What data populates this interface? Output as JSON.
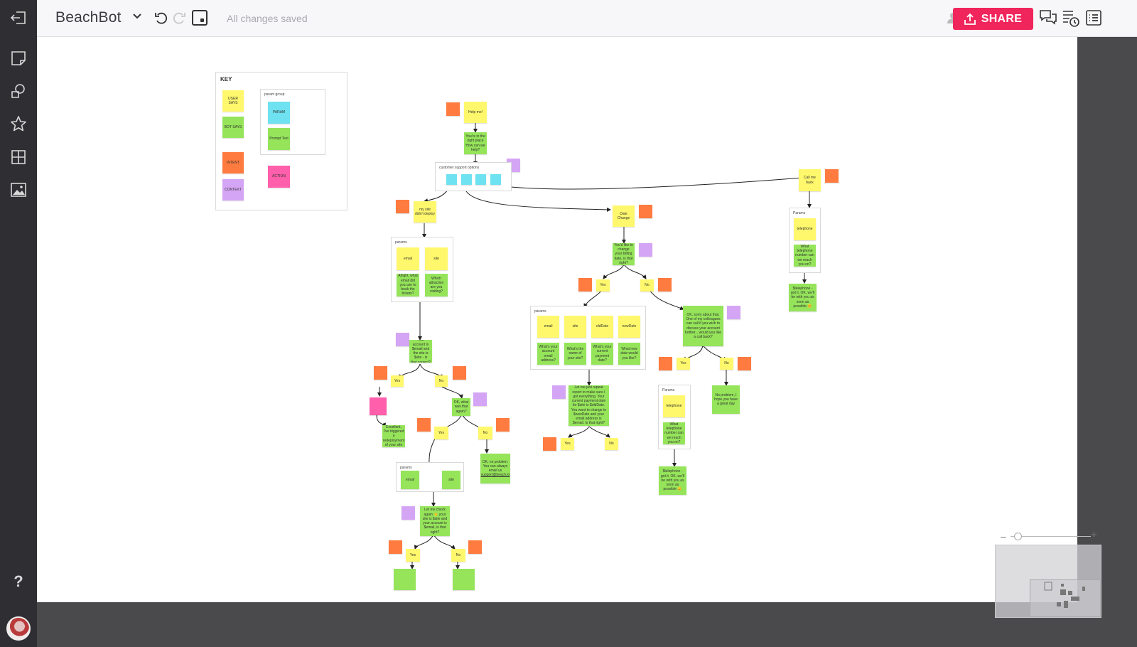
{
  "topbar": {
    "board_title": "BeachBot",
    "save_status": "All changes saved",
    "user_count": "1",
    "share_label": "SHARE"
  },
  "colors": {
    "accent": "#f0255b",
    "user_says": "#fff86c",
    "bot_says": "#95e45a",
    "intent": "#ff7b3f",
    "context": "#d5a5f5",
    "param": "#6ee2f0",
    "action": "#ff5fab"
  },
  "key": {
    "title": "KEY",
    "user_says": "USER SAYS",
    "bot_says": "BOT SAYS",
    "intent": "INTENT",
    "context": "CONTEXT",
    "param_group": "param group",
    "param": "PARAM",
    "prompt_text": "Prompt Text",
    "action": "ACTION"
  },
  "flow": {
    "help_me": "Help me!",
    "youre_in_right_place": "You're in the right place How can we help?",
    "customer_support_options": "customer support options",
    "my_site_didnt_deploy": "my site didn't deploy",
    "params_label": "params",
    "email": "email",
    "site": "site",
    "ask_email": "Alright, what email did you use to book the tickets?",
    "ask_site": "Which attraction are you visiting?",
    "confirm_account": "Your account is $email and the site is $site - is that correct?",
    "yes": "Yes",
    "no": "No",
    "redeployment": "Excellent, I've triggered a redeployment of your site",
    "ok_what_say": "OK, what was that again?",
    "no_problem_email": "OK, no problem. You can always email us",
    "support_email": "support@beach.io",
    "params_label2": "params",
    "check_again": "Let me check again 👋 your site is $site and your account is $email, is that right?",
    "date_change": "Date Change",
    "billing_date": "You'd like to change your billing date, is that right?",
    "params_label3": "params",
    "old_date": "oldDate",
    "new_date": "newDate",
    "q_email": "What's your account email address?",
    "q_site": "What's the name of your site?",
    "q_old_date": "What's your current payment date?",
    "q_new_date": "What new date would you like?",
    "repeat_back": "Let me just repeat report to make sure I got everything. Your current payment date for $site is $oldDate. You want to change to $newDate and your email address is $email. Is that right?",
    "sorry_call": "OK, sorry about that. One of my colleagues can call if you wish to discuss your account further... would you like a call back?",
    "params_cap": "Params",
    "telephone": "telephone",
    "what_telephone": "What telephone number can we reach you on?",
    "got_it_telephone": "$telephone - got it. OK, we'll be with you as soon as possible 😊",
    "no_problem_great_day": "No problem, I hope you have a great day",
    "call_me_back": "Call me back"
  },
  "zoom": {
    "minus": "–",
    "plus": "+"
  }
}
